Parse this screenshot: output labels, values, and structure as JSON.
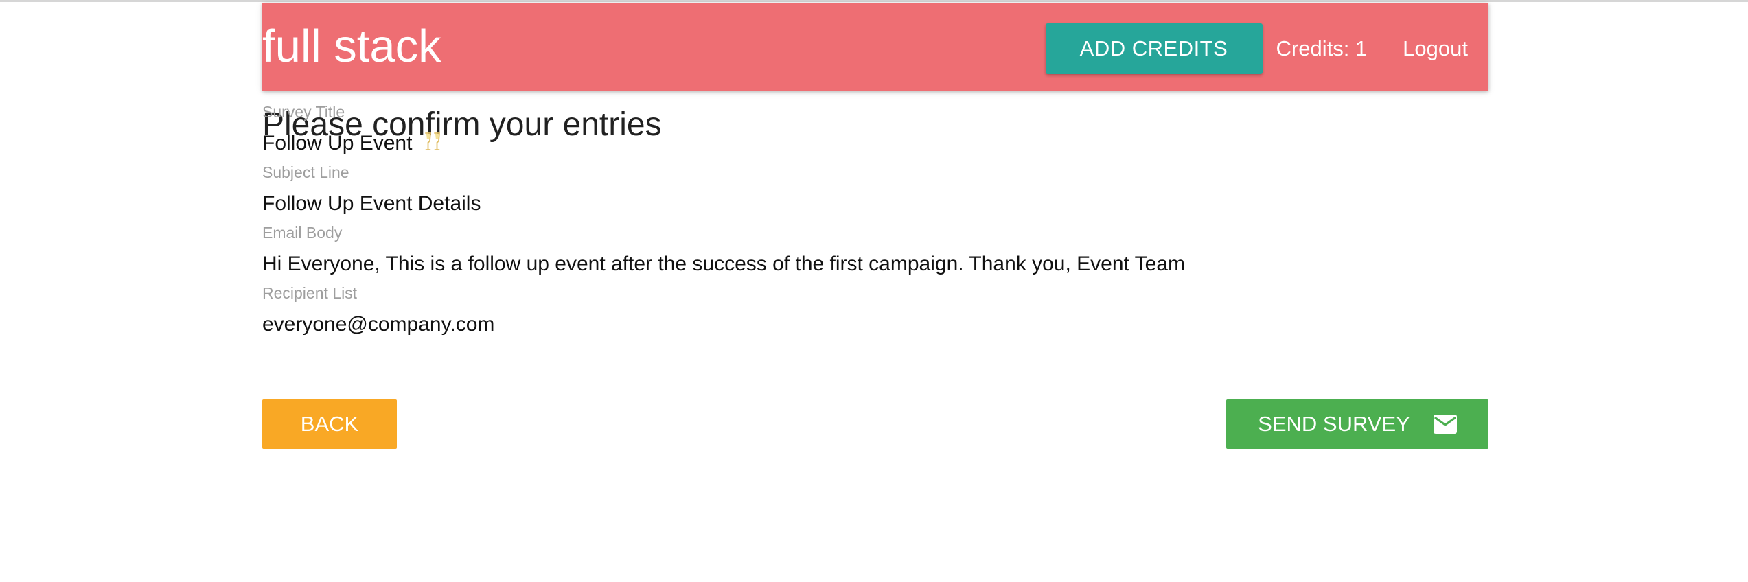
{
  "header": {
    "brand": "full stack",
    "add_credits_label": "ADD CREDITS",
    "credits_text": "Credits: 1",
    "logout_label": "Logout"
  },
  "page": {
    "title": "Please confirm your entries"
  },
  "fields": [
    {
      "label": "Survey Title",
      "value": "Follow Up Event",
      "trailing_icon": "champagne-glasses-emoji"
    },
    {
      "label": "Subject Line",
      "value": "Follow Up Event Details"
    },
    {
      "label": "Email Body",
      "value": "Hi Everyone, This is a follow up event after the success of the first campaign. Thank you, Event Team"
    },
    {
      "label": "Recipient List",
      "value": "everyone@company.com"
    }
  ],
  "actions": {
    "back_label": "BACK",
    "send_label": "SEND SURVEY",
    "send_icon": "mail-icon"
  },
  "colors": {
    "navbar": "#ee6e73",
    "add_credits_button": "#26a69a",
    "back_button": "#f9a825",
    "send_button": "#4caf50",
    "label_text": "#9e9e9e"
  }
}
